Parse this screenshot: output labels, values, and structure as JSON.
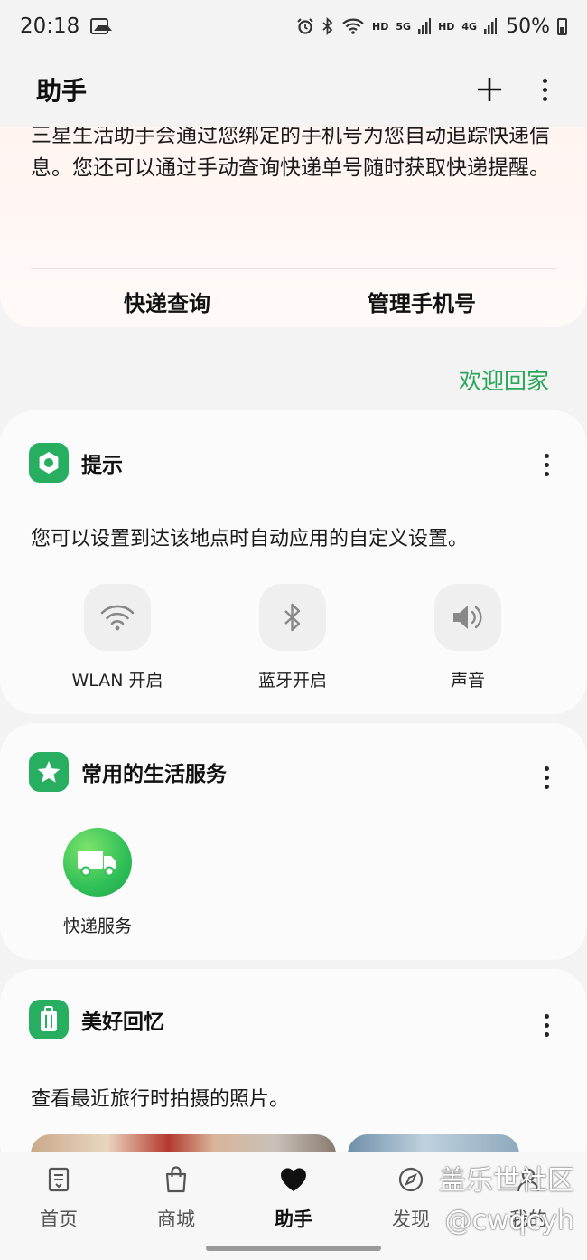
{
  "status_bar": {
    "time": "20:18",
    "hd1": "HD",
    "net1": "5G",
    "hd2": "HD",
    "net2": "4G",
    "battery": "50%"
  },
  "app_bar": {
    "title": "助手"
  },
  "top_card": {
    "paragraph": "三星生活助手会通过您绑定的手机号为您自动追踪快递信息。您还可以通过手动查询快递单号随时获取快递提醒。",
    "button_left": "快递查询",
    "button_right": "管理手机号"
  },
  "welcome_link": "欢迎回家",
  "tips_card": {
    "title": "提示",
    "description": "您可以设置到达该地点时自动应用的自定义设置。",
    "toggles": [
      {
        "label": "WLAN 开启",
        "icon": "wifi-icon"
      },
      {
        "label": "蓝牙开启",
        "icon": "bluetooth-icon"
      },
      {
        "label": "声音",
        "icon": "speaker-icon"
      }
    ]
  },
  "services_card": {
    "title": "常用的生活服务",
    "items": [
      {
        "label": "快递服务",
        "icon": "truck-icon"
      }
    ]
  },
  "memories_card": {
    "title": "美好回忆",
    "description": "查看最近旅行时拍摄的照片。"
  },
  "bottom_nav": {
    "items": [
      {
        "label": "首页",
        "icon": "home-icon"
      },
      {
        "label": "商城",
        "icon": "shopping-bag-icon"
      },
      {
        "label": "助手",
        "icon": "heart-icon"
      },
      {
        "label": "发现",
        "icon": "compass-icon"
      },
      {
        "label": "我的",
        "icon": "profile-icon"
      }
    ],
    "active": "助手"
  },
  "watermark": {
    "line1": "盖乐世社区",
    "line2": "@cwqcyh"
  },
  "colors": {
    "accent_green": "#27ae60",
    "link_green": "#2aa65a"
  }
}
